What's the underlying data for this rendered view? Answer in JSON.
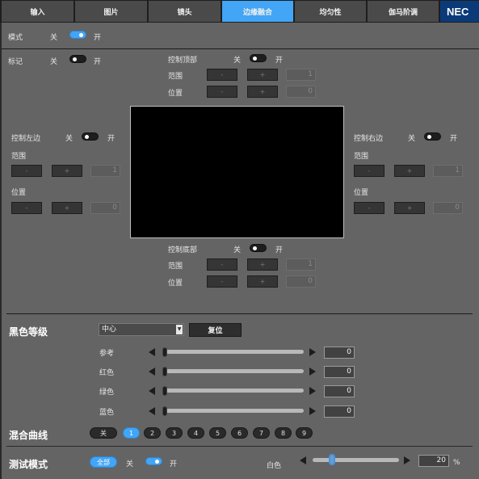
{
  "tabs": [
    {
      "label": "输入",
      "active": false
    },
    {
      "label": "图片",
      "active": false
    },
    {
      "label": "镜头",
      "active": false
    },
    {
      "label": "边缘融合",
      "active": true
    },
    {
      "label": "均匀性",
      "active": false
    },
    {
      "label": "伽马阶调",
      "active": false
    }
  ],
  "brand": "NEC",
  "colors": {
    "accent": "#42a5f5",
    "brand": "#0b3a78",
    "background": "#646464"
  },
  "mode": {
    "label": "模式",
    "off": "关",
    "on": "开",
    "state": "on"
  },
  "marker": {
    "label": "标记",
    "off": "关",
    "on": "开",
    "state": "off"
  },
  "edges": {
    "top": {
      "label": "控制顶部",
      "off": "关",
      "on": "开",
      "state": "off",
      "range_label": "范围",
      "range_value": "1",
      "position_label": "位置",
      "position_value": "0",
      "minus": "-",
      "plus": "+"
    },
    "left": {
      "label": "控制左边",
      "off": "关",
      "on": "开",
      "state": "off",
      "range_label": "范围",
      "range_value": "1",
      "position_label": "位置",
      "position_value": "0",
      "minus": "-",
      "plus": "+"
    },
    "right": {
      "label": "控制右边",
      "off": "关",
      "on": "开",
      "state": "off",
      "range_label": "范围",
      "range_value": "1",
      "position_label": "位置",
      "position_value": "0",
      "minus": "-",
      "plus": "+"
    },
    "bottom": {
      "label": "控制底部",
      "off": "关",
      "on": "开",
      "state": "off",
      "range_label": "范围",
      "range_value": "1",
      "position_label": "位置",
      "position_value": "0",
      "minus": "-",
      "plus": "+"
    }
  },
  "black_level": {
    "title": "黑色等级",
    "select_value": "中心",
    "reset_label": "复位",
    "sliders": [
      {
        "label": "参考",
        "value": "0",
        "fraction": 0
      },
      {
        "label": "红色",
        "value": "0",
        "fraction": 0
      },
      {
        "label": "绿色",
        "value": "0",
        "fraction": 0
      },
      {
        "label": "蓝色",
        "value": "0",
        "fraction": 0
      }
    ]
  },
  "blend_curve": {
    "title": "混合曲线",
    "options": [
      "关",
      "1",
      "2",
      "3",
      "4",
      "5",
      "6",
      "7",
      "8",
      "9"
    ],
    "selected": "1"
  },
  "test_mode": {
    "title": "测试模式",
    "all_label": "全部",
    "off": "关",
    "on": "开",
    "state": "on",
    "white_label": "白色",
    "white_value": "20",
    "white_fraction": 0.2,
    "unit": "%"
  }
}
